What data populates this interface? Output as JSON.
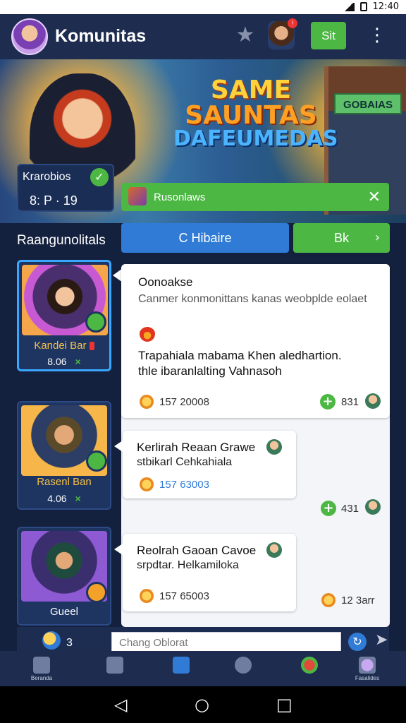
{
  "status_bar": {
    "time": "12:40"
  },
  "appbar": {
    "title": "Komunitas",
    "action_label": "Sit",
    "profile_badge": "!"
  },
  "banner": {
    "logo_line1": "SAME",
    "logo_line2": "SAUNTAS",
    "logo_line3": "DAFEUMEDAS",
    "building_sign": "GOBAIAS"
  },
  "user_card": {
    "name": "Krarobios",
    "stats": "8: P · 19"
  },
  "notice": {
    "text": "Rusonlaws"
  },
  "section": {
    "label": "Raangunolitals"
  },
  "tabs": [
    {
      "label": "C Hibaire"
    },
    {
      "label": "Bk"
    }
  ],
  "characters": [
    {
      "name": "Kandei Bar",
      "value": "8.06"
    },
    {
      "name": "Rasenl Ban",
      "value": "4.06"
    },
    {
      "name": "Gueel"
    }
  ],
  "posts": [
    {
      "title": "Oonoakse",
      "subtitle": "Canmer konmonittans kanas weobplde eolaet",
      "body_line1": "Trapahiala mabama Khen aledhartion.",
      "body_line2": "thle ibaranlalting Vahnasoh",
      "likes": "157 20008",
      "score": "831"
    },
    {
      "title": "Kerlirah Reaan Grawe",
      "subtitle": "stbikarl Cehkahiala",
      "likes": "157 63003",
      "score": "431"
    },
    {
      "title": "Reolrah Gaoan Cavoe",
      "subtitle": "srpdtar. Helkamiloka",
      "likes": "157 65003",
      "score": "12 3arr"
    }
  ],
  "composer": {
    "count": "3",
    "placeholder": "Chang Oblorat"
  },
  "bottom_nav": [
    {
      "label": "Beranda"
    },
    {
      "label": ""
    },
    {
      "label": ""
    },
    {
      "label": ""
    },
    {
      "label": ""
    },
    {
      "label": "Fasalides"
    }
  ],
  "colors": {
    "accent_green": "#4cb843",
    "accent_blue": "#2f7bd6",
    "background": "#14213e"
  }
}
